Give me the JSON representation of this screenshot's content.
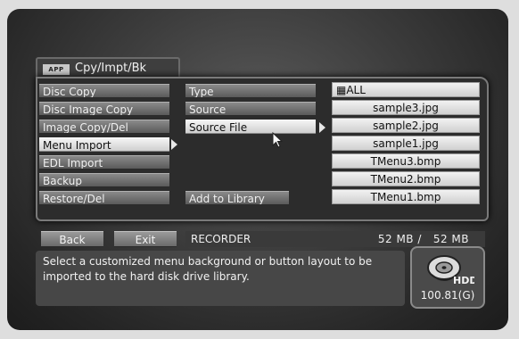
{
  "category": {
    "badge": "APP",
    "title": "Cpy/Impt/Bk"
  },
  "menu": {
    "items": [
      {
        "label": "Disc Copy",
        "active": false
      },
      {
        "label": "Disc Image Copy",
        "active": false
      },
      {
        "label": "Image Copy/Del",
        "active": false
      },
      {
        "label": "Menu Import",
        "active": true
      },
      {
        "label": "EDL Import",
        "active": false
      },
      {
        "label": "Backup",
        "active": false
      },
      {
        "label": "Restore/Del",
        "active": false
      }
    ]
  },
  "options": {
    "type_label": "Type",
    "source_label": "Source",
    "source_file_label": "Source File",
    "add_button": "Add to Library"
  },
  "files": [
    "▦ALL",
    "sample3.jpg",
    "sample2.jpg",
    "sample1.jpg",
    "TMenu3.bmp",
    "TMenu2.bmp",
    "TMenu1.bmp"
  ],
  "footer": {
    "back": "Back",
    "exit": "Exit",
    "device": "RECORDER",
    "capacity": "52 MB /   52 MB"
  },
  "message": "Select a customized menu background or button layout to be imported to the hard disk drive library.",
  "hdd": {
    "icon_label": "HDD",
    "free": "100.81(G)"
  }
}
